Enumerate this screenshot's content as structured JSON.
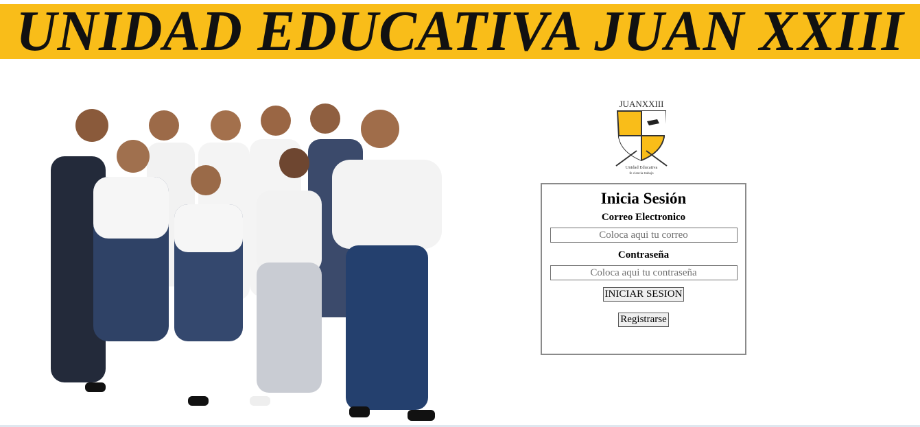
{
  "banner": {
    "title": "UNIDAD EDUCATIVA JUAN XXIII",
    "color": "#f9bd19"
  },
  "photo": {
    "alt": "students"
  },
  "logo": {
    "top_text": "JUANXXIII",
    "caption_line1": "Unidad Educativa",
    "caption_line2": "fe·ciencia·trabajo"
  },
  "login": {
    "title": "Inicia Sesión",
    "email_label": "Correo Electronico",
    "email_placeholder": "Coloca aqui tu correo",
    "email_value": "",
    "password_label": "Contraseña",
    "password_placeholder": "Coloca aqui tu contraseña",
    "password_value": "",
    "submit_label": "INICIAR SESION",
    "register_label": "Registrarse"
  }
}
